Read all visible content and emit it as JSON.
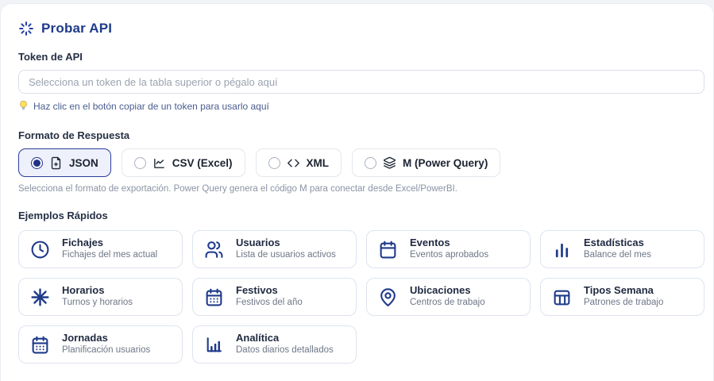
{
  "header": {
    "title": "Probar API",
    "icon": "loader-icon"
  },
  "token": {
    "label": "Token de API",
    "placeholder": "Selecciona un token de la tabla superior o pégalo aquí",
    "hint": "Haz clic en el botón copiar de un token para usarlo aquí"
  },
  "format": {
    "label": "Formato de Respuesta",
    "help": "Selecciona el formato de exportación. Power Query genera el código M para conectar desde Excel/PowerBI.",
    "options": [
      {
        "label": "JSON",
        "icon": "file-plus-icon",
        "selected": true
      },
      {
        "label": "CSV (Excel)",
        "icon": "chart-line-icon",
        "selected": false
      },
      {
        "label": "XML",
        "icon": "code-icon",
        "selected": false
      },
      {
        "label": "M (Power Query)",
        "icon": "layers-icon",
        "selected": false
      }
    ]
  },
  "examples": {
    "label": "Ejemplos Rápidos",
    "cards": [
      {
        "title": "Fichajes",
        "subtitle": "Fichajes del mes actual",
        "icon": "clock-icon"
      },
      {
        "title": "Usuarios",
        "subtitle": "Lista de usuarios activos",
        "icon": "users-icon"
      },
      {
        "title": "Eventos",
        "subtitle": "Eventos aprobados",
        "icon": "calendar-icon"
      },
      {
        "title": "Estadísticas",
        "subtitle": "Balance del mes",
        "icon": "bar-chart-icon"
      },
      {
        "title": "Horarios",
        "subtitle": "Turnos y horarios",
        "icon": "asterisk-icon"
      },
      {
        "title": "Festivos",
        "subtitle": "Festivos del año",
        "icon": "calendar-days-icon"
      },
      {
        "title": "Ubicaciones",
        "subtitle": "Centros de trabajo",
        "icon": "map-pin-icon"
      },
      {
        "title": "Tipos Semana",
        "subtitle": "Patrones de trabajo",
        "icon": "table-icon"
      },
      {
        "title": "Jornadas",
        "subtitle": "Planificación usuarios",
        "icon": "calendar-days-icon"
      },
      {
        "title": "Analítica",
        "subtitle": "Datos diarios detallados",
        "icon": "chart-axis-icon"
      }
    ]
  },
  "colors": {
    "accent": "#1e3a8a",
    "selected_border": "#2b3d9a",
    "selected_bg": "#eef0fb",
    "hint_text": "#4a5d8f",
    "bulb_yellow": "#fde25f"
  }
}
